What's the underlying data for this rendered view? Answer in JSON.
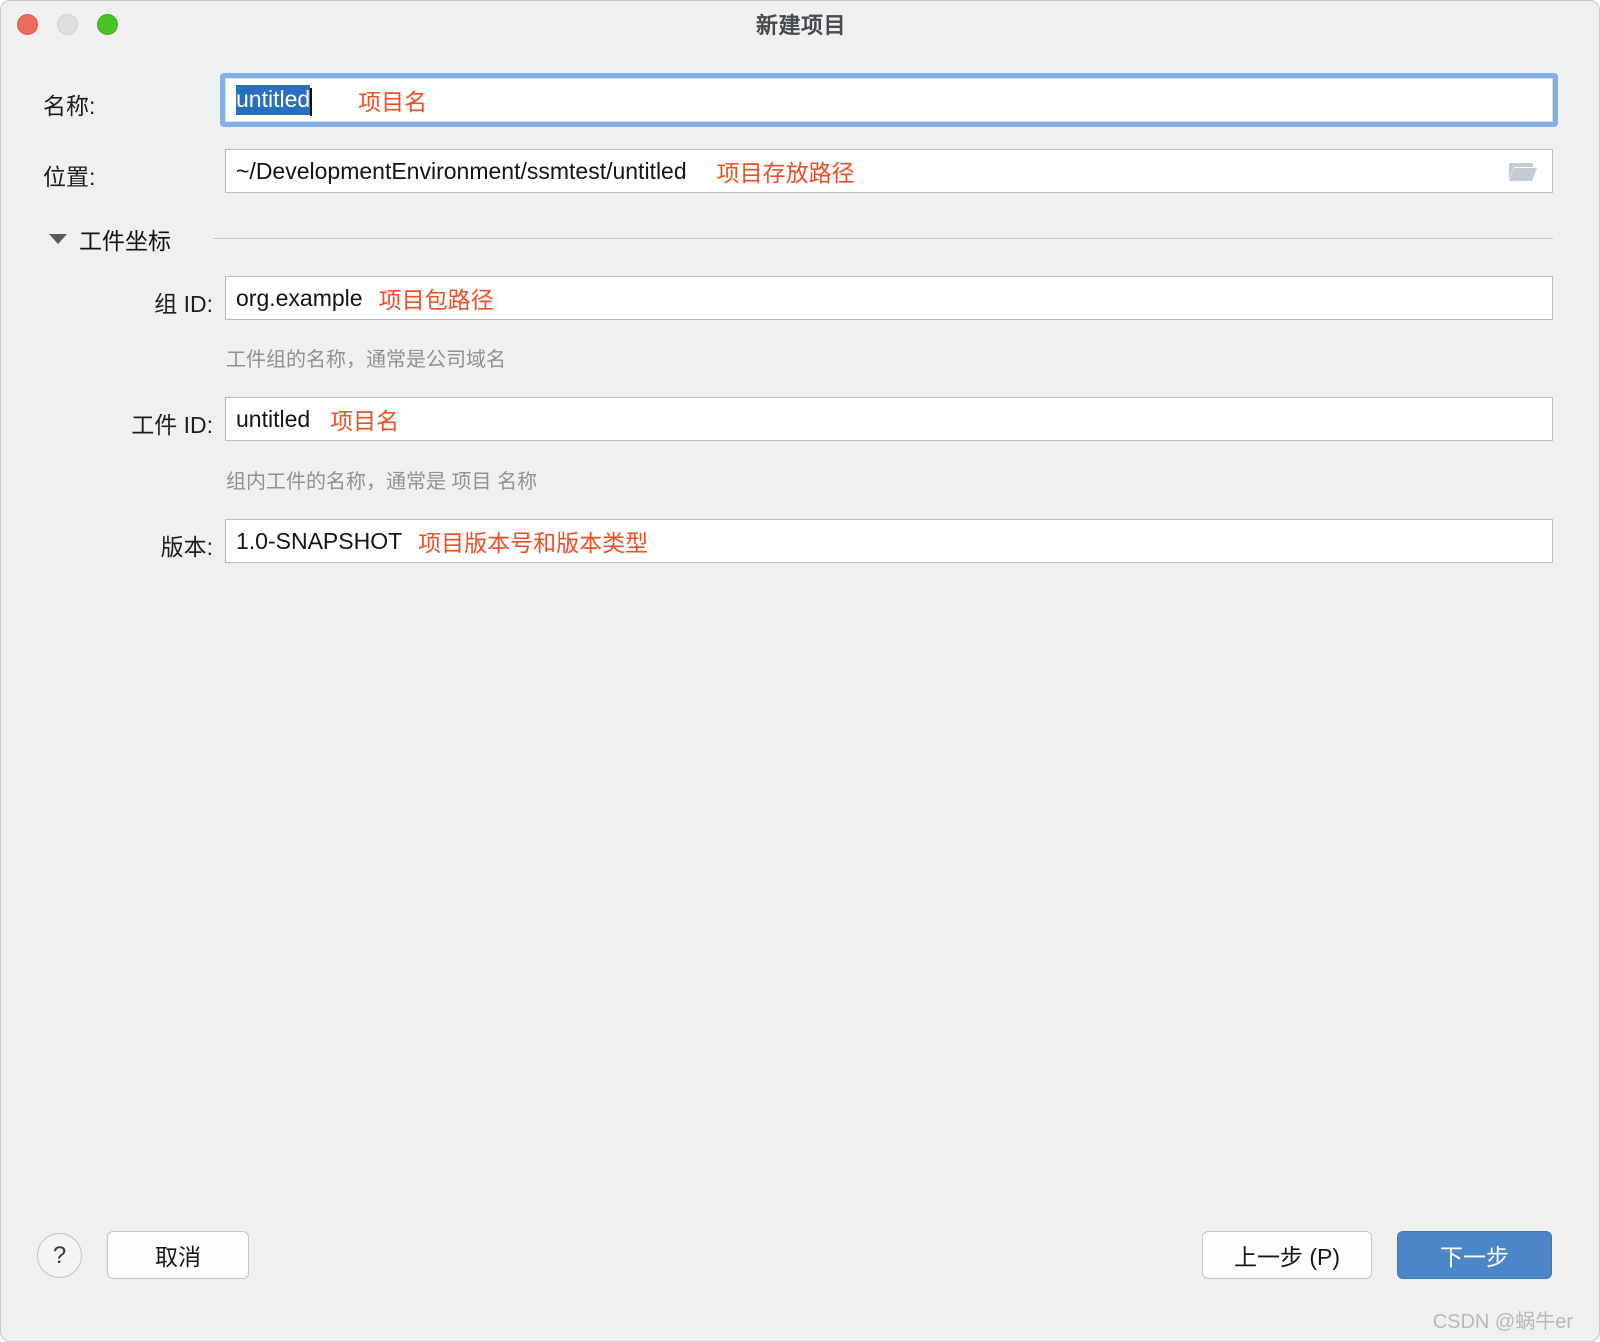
{
  "window": {
    "title": "新建项目",
    "traffic_lights": [
      {
        "name": "close",
        "color": "#ec6a5e"
      },
      {
        "name": "minimize",
        "color": "#dedede"
      },
      {
        "name": "maximize",
        "color": "#4ac228"
      }
    ]
  },
  "accent_colors": {
    "annotation_red": "#f04e23",
    "primary_button_blue": "#4a86c8",
    "selection_blue": "#2a6ec0",
    "focus_ring_blue": "#80b0e7"
  },
  "form": {
    "name": {
      "label": "名称:",
      "value": "untitled",
      "selected": true,
      "annotation": "项目名"
    },
    "location": {
      "label": "位置:",
      "value": "~/DevelopmentEnvironment/ssmtest/untitled",
      "annotation": "项目存放路径",
      "browse_icon": "folder-icon"
    },
    "section": {
      "title": "工件坐标",
      "expanded": true,
      "disclosure_icon": "triangle-down-icon"
    },
    "group_id": {
      "label": "组 ID:",
      "value": "org.example",
      "annotation": "项目包路径",
      "hint": "工件组的名称，通常是公司域名"
    },
    "artifact_id": {
      "label": "工件 ID:",
      "value": "untitled",
      "annotation": "项目名",
      "hint": "组内工件的名称，通常是 项目 名称"
    },
    "version": {
      "label": "版本:",
      "value": "1.0-SNAPSHOT",
      "annotation": "项目版本号和版本类型"
    }
  },
  "footer": {
    "help_label": "?",
    "cancel_label": "取消",
    "previous_label": "上一步 (P)",
    "next_label": "下一步"
  },
  "watermark": "CSDN @蜗牛er"
}
